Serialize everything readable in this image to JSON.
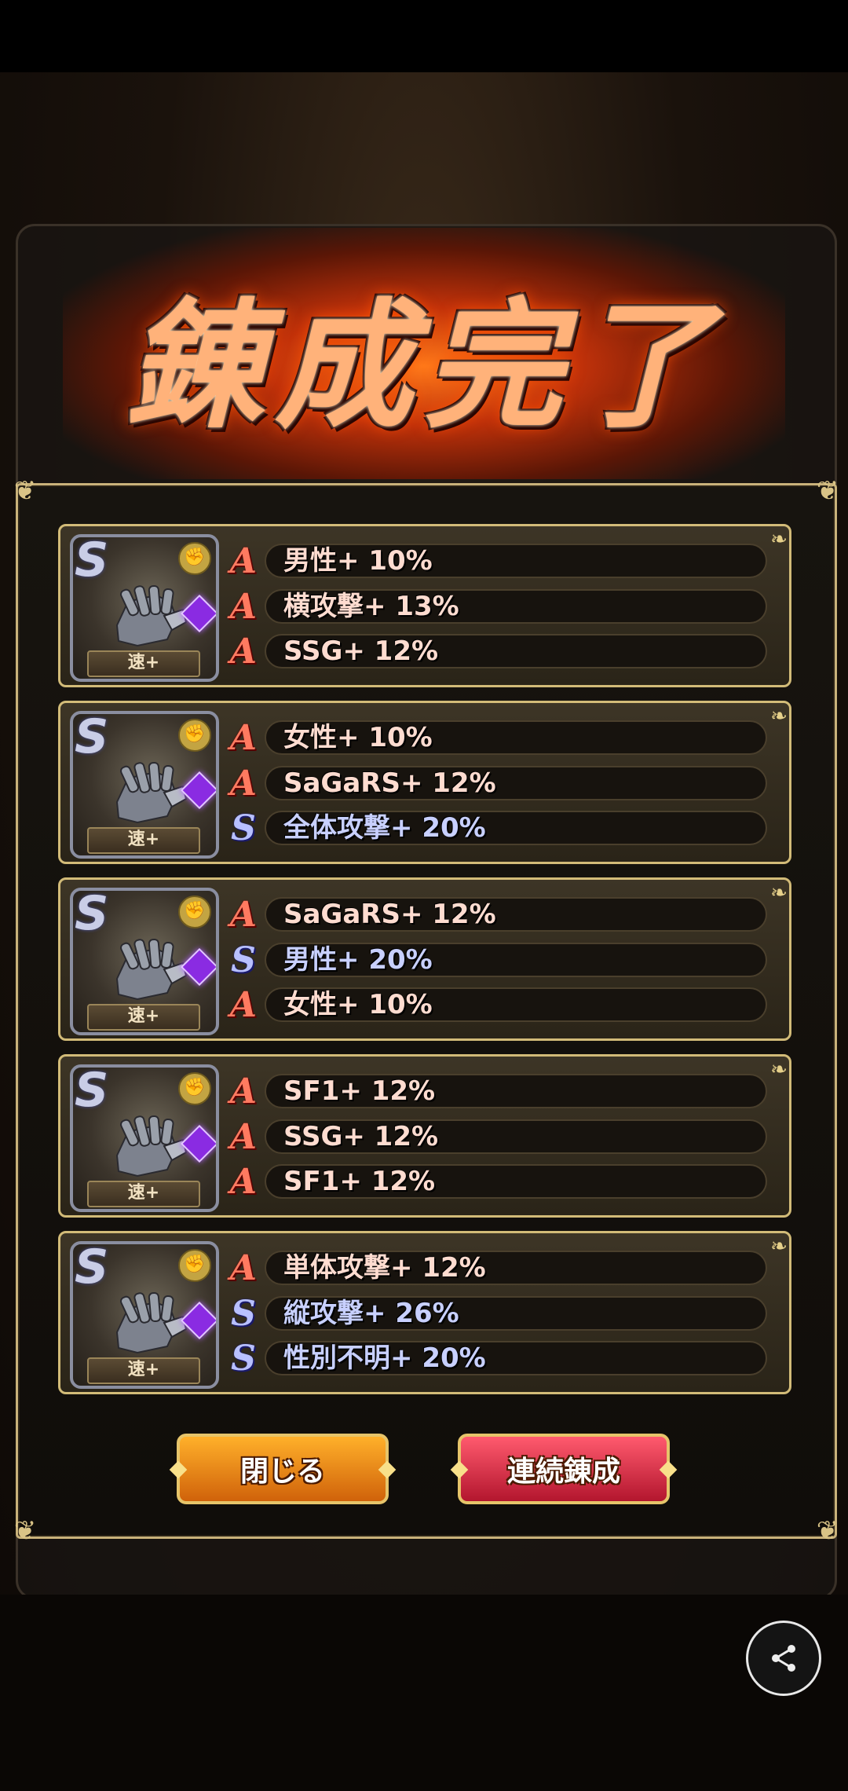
{
  "title": "錬成完了",
  "results": [
    {
      "badge": "速+",
      "stats": [
        {
          "grade": "A",
          "text": "男性+ 10%"
        },
        {
          "grade": "A",
          "text": "横攻撃+ 13%"
        },
        {
          "grade": "A",
          "text": "SSG+ 12%"
        }
      ]
    },
    {
      "badge": "速+",
      "stats": [
        {
          "grade": "A",
          "text": "女性+ 10%"
        },
        {
          "grade": "A",
          "text": "SaGaRS+ 12%"
        },
        {
          "grade": "S",
          "text": "全体攻撃+ 20%"
        }
      ]
    },
    {
      "badge": "速+",
      "stats": [
        {
          "grade": "A",
          "text": "SaGaRS+ 12%"
        },
        {
          "grade": "S",
          "text": "男性+ 20%"
        },
        {
          "grade": "A",
          "text": "女性+ 10%"
        }
      ]
    },
    {
      "badge": "速+",
      "stats": [
        {
          "grade": "A",
          "text": "SF1+ 12%"
        },
        {
          "grade": "A",
          "text": "SSG+ 12%"
        },
        {
          "grade": "A",
          "text": "SF1+ 12%"
        }
      ]
    },
    {
      "badge": "速+",
      "stats": [
        {
          "grade": "A",
          "text": "単体攻撃+ 12%"
        },
        {
          "grade": "S",
          "text": "縦攻撃+ 26%"
        },
        {
          "grade": "S",
          "text": "性別不明+ 20%"
        }
      ]
    }
  ],
  "buttons": {
    "close_label": "閉じる",
    "repeat_label": "連続錬成"
  },
  "icons": {
    "share": "share-icon",
    "item": "gauntlet-icon",
    "weapon_type": "fist-icon",
    "slot": "purple-gem-icon"
  },
  "colors": {
    "grade_A": "#ff7a60",
    "grade_S": "#b8c0ff",
    "close_button": "#ffb02a",
    "repeat_button": "#ff5a6e",
    "frame_gold": "#d2bb78"
  }
}
